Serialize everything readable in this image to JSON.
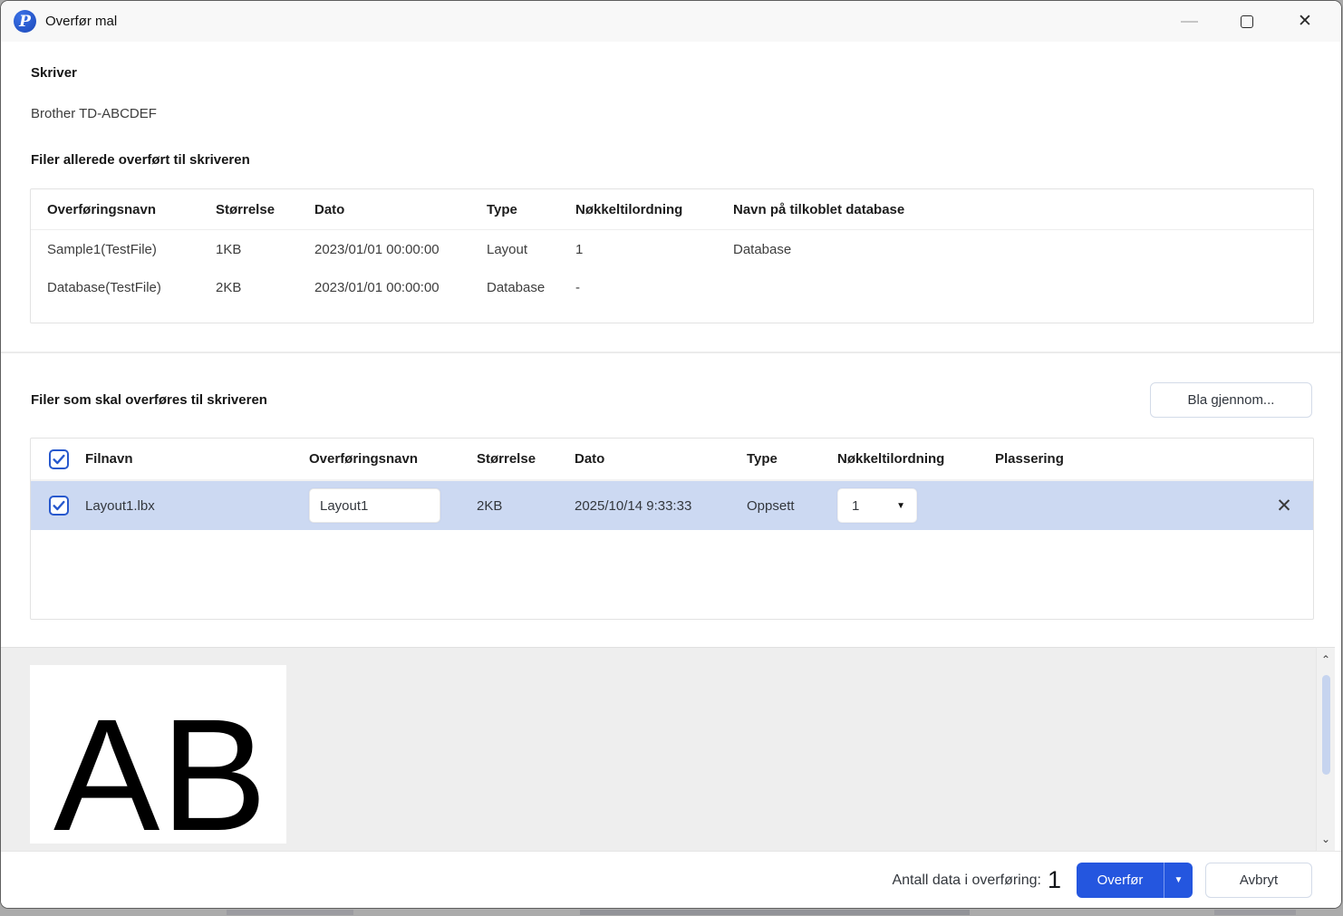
{
  "window": {
    "title": "Overfør mal",
    "icons": {
      "app": "P",
      "minimize": "minimize-dash",
      "maximize": "maximize-square",
      "close": "✕"
    }
  },
  "printer_section": {
    "label": "Skriver",
    "printer_name": "Brother TD-ABCDEF"
  },
  "transferred_section": {
    "title": "Filer allerede overført til skriveren",
    "columns": {
      "name": "Overføringsnavn",
      "size": "Størrelse",
      "date": "Dato",
      "type": "Type",
      "key": "Nøkkeltilordning",
      "database": "Navn på tilkoblet database"
    },
    "rows": [
      {
        "name": "Sample1(TestFile)",
        "size": "1KB",
        "date": "2023/01/01 00:00:00",
        "type": "Layout",
        "key": "1",
        "database": "Database"
      },
      {
        "name": "Database(TestFile)",
        "size": "2KB",
        "date": "2023/01/01 00:00:00",
        "type": "Database",
        "key": "-",
        "database": ""
      }
    ]
  },
  "transfer_section": {
    "title": "Filer som skal overføres til skriveren",
    "browse_button": "Bla gjennom...",
    "columns": {
      "filename": "Filnavn",
      "transfer_name": "Overføringsnavn",
      "size": "Størrelse",
      "date": "Dato",
      "type": "Type",
      "key": "Nøkkeltilordning",
      "placement": "Plassering"
    },
    "rows": [
      {
        "checked": true,
        "filename": "Layout1.lbx",
        "transfer_name": "Layout1",
        "size": "2KB",
        "date": "2025/10/14 9:33:33",
        "type": "Oppsett",
        "key": "1",
        "placement": "",
        "delete_icon": "✕"
      }
    ]
  },
  "preview": {
    "text": "AB"
  },
  "scrollbar": {
    "up_icon": "⌃",
    "down_icon": "⌄"
  },
  "footer": {
    "count_label": "Antall data i overføring:",
    "count": "1",
    "transfer_button": "Overfør",
    "transfer_arrow_icon": "▼",
    "cancel_button": "Avbryt"
  },
  "colors": {
    "accent_blue": "#2456df",
    "row_highlight": "#ccd9f2",
    "checkbox_blue": "#2758cd",
    "titlebar_bg": "#f8f8f8",
    "preview_bg": "#eeeeee"
  }
}
